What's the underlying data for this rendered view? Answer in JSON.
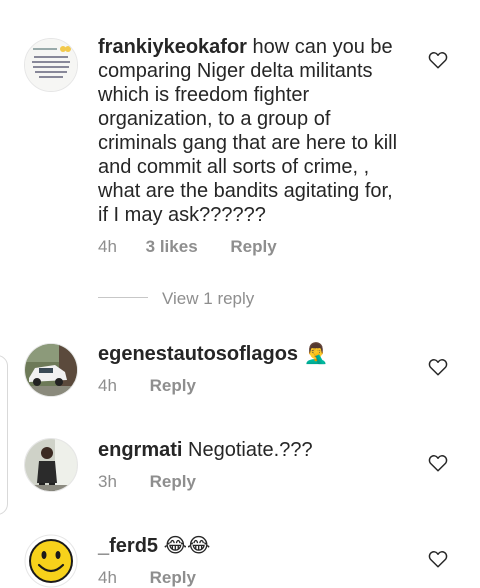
{
  "comments": [
    {
      "username": "frankiykeokafor",
      "text": "how can you be comparing Niger delta militants which is freedom fighter organization, to a group of criminals gang that are here to kill and commit all sorts of crime, , what  are the bandits agitating for, if I may ask??????",
      "time": "4h",
      "likes": "3 likes",
      "reply": "Reply",
      "avatar_icon": "text-post-avatar",
      "avatar_text": "frankiykeokafor was saying they could not be blamed for this"
    },
    {
      "username": "egenestautosoflagos",
      "emoji": "🤦‍♂️",
      "text": "",
      "time": "4h",
      "reply": "Reply",
      "avatar_icon": "car-avatar"
    },
    {
      "username": "engrmati",
      "text": "Negotiate.???",
      "time": "3h",
      "reply": "Reply",
      "avatar_icon": "person-avatar"
    },
    {
      "username": "_ferd5",
      "text": "😂😂",
      "time": "4h",
      "reply": "Reply",
      "avatar_icon": "smiley-avatar"
    }
  ],
  "view_replies": "View 1 reply",
  "colors": {
    "text": "#262626",
    "meta": "#8e8e8e",
    "smiley": "#f7d21b"
  }
}
